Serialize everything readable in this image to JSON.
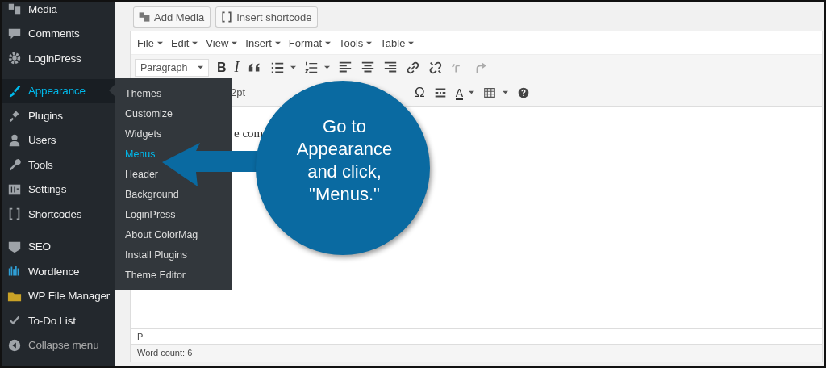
{
  "sidebar": {
    "groups": [
      {
        "items": [
          {
            "label": "Media",
            "selected": false
          },
          {
            "label": "Comments",
            "selected": false
          },
          {
            "label": "LoginPress",
            "selected": false
          }
        ]
      },
      {
        "items": [
          {
            "label": "Appearance",
            "selected": true
          },
          {
            "label": "Plugins",
            "selected": false
          },
          {
            "label": "Users",
            "selected": false
          },
          {
            "label": "Tools",
            "selected": false
          },
          {
            "label": "Settings",
            "selected": false
          },
          {
            "label": "Shortcodes",
            "selected": false
          }
        ]
      },
      {
        "items": [
          {
            "label": "SEO",
            "selected": false
          },
          {
            "label": "Wordfence",
            "selected": false
          },
          {
            "label": "WP File Manager",
            "selected": false
          },
          {
            "label": "To-Do List",
            "selected": false
          },
          {
            "label": "Collapse menu",
            "selected": false
          }
        ]
      }
    ]
  },
  "submenu": {
    "items": [
      {
        "label": "Themes",
        "selected": false
      },
      {
        "label": "Customize",
        "selected": false
      },
      {
        "label": "Widgets",
        "selected": false
      },
      {
        "label": "Menus",
        "selected": true
      },
      {
        "label": "Header",
        "selected": false
      },
      {
        "label": "Background",
        "selected": false
      },
      {
        "label": "LoginPress",
        "selected": false
      },
      {
        "label": "About ColorMag",
        "selected": false
      },
      {
        "label": "Install Plugins",
        "selected": false
      },
      {
        "label": "Theme Editor",
        "selected": false
      }
    ]
  },
  "editor": {
    "buttons": [
      "Add Media",
      "Insert shortcode"
    ],
    "menubar": [
      "File",
      "Edit",
      "View",
      "Insert",
      "Format",
      "Tools",
      "Table"
    ],
    "format_select": "Paragraph",
    "bold": "B",
    "italic": "I",
    "font_size": "2pt",
    "special_char": "Ω",
    "text_color": "A",
    "content": "e com",
    "path": "P",
    "word_count": "Word count: 6"
  },
  "callout": {
    "lines": [
      "Go to",
      "Appearance",
      "and click,",
      "\"Menus.\""
    ]
  }
}
